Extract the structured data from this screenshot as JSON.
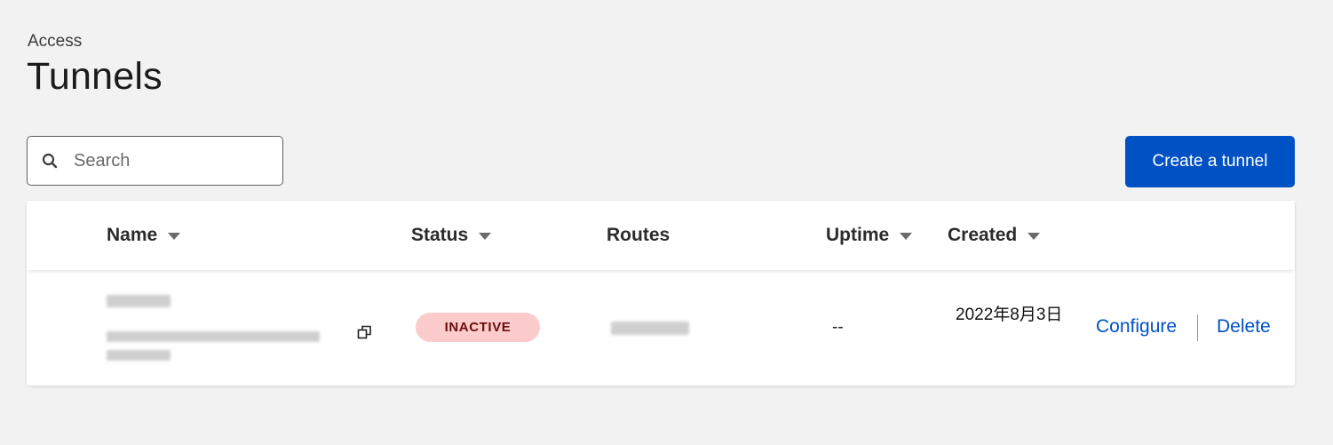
{
  "breadcrumb": "Access",
  "page_title": "Tunnels",
  "search": {
    "placeholder": "Search",
    "icon": "search-icon"
  },
  "create_button": {
    "label": "Create a tunnel"
  },
  "colors": {
    "accent": "#0051c3",
    "background": "#f2f2f2",
    "inactive_badge_bg": "#fccbcb",
    "inactive_badge_text": "#6b0d0d"
  },
  "table": {
    "columns": [
      {
        "label": "Name",
        "sortable": true
      },
      {
        "label": "Status",
        "sortable": true
      },
      {
        "label": "Routes",
        "sortable": false
      },
      {
        "label": "Uptime",
        "sortable": true
      },
      {
        "label": "Created",
        "sortable": true
      }
    ],
    "rows": [
      {
        "status": "INACTIVE",
        "uptime": "--",
        "created": "2022年8月3日",
        "actions": {
          "configure": "Configure",
          "delete": "Delete"
        }
      }
    ]
  }
}
